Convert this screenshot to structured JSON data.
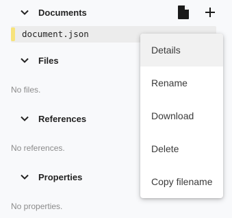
{
  "sections": {
    "documents": {
      "title": "Documents"
    },
    "files": {
      "title": "Files",
      "empty": "No files."
    },
    "references": {
      "title": "References",
      "empty": "No references."
    },
    "properties": {
      "title": "Properties",
      "empty": "No properties."
    }
  },
  "documents": {
    "items": [
      {
        "name": "document.json",
        "color": "#f7e37a"
      }
    ]
  },
  "context_menu": {
    "items": [
      {
        "label": "Details",
        "highlighted": true
      },
      {
        "label": "Rename"
      },
      {
        "label": "Download"
      },
      {
        "label": "Delete"
      },
      {
        "label": "Copy filename"
      }
    ]
  },
  "icons": {
    "chevron": "chevron-down-icon",
    "new_document": "document-icon",
    "add": "plus-icon"
  }
}
